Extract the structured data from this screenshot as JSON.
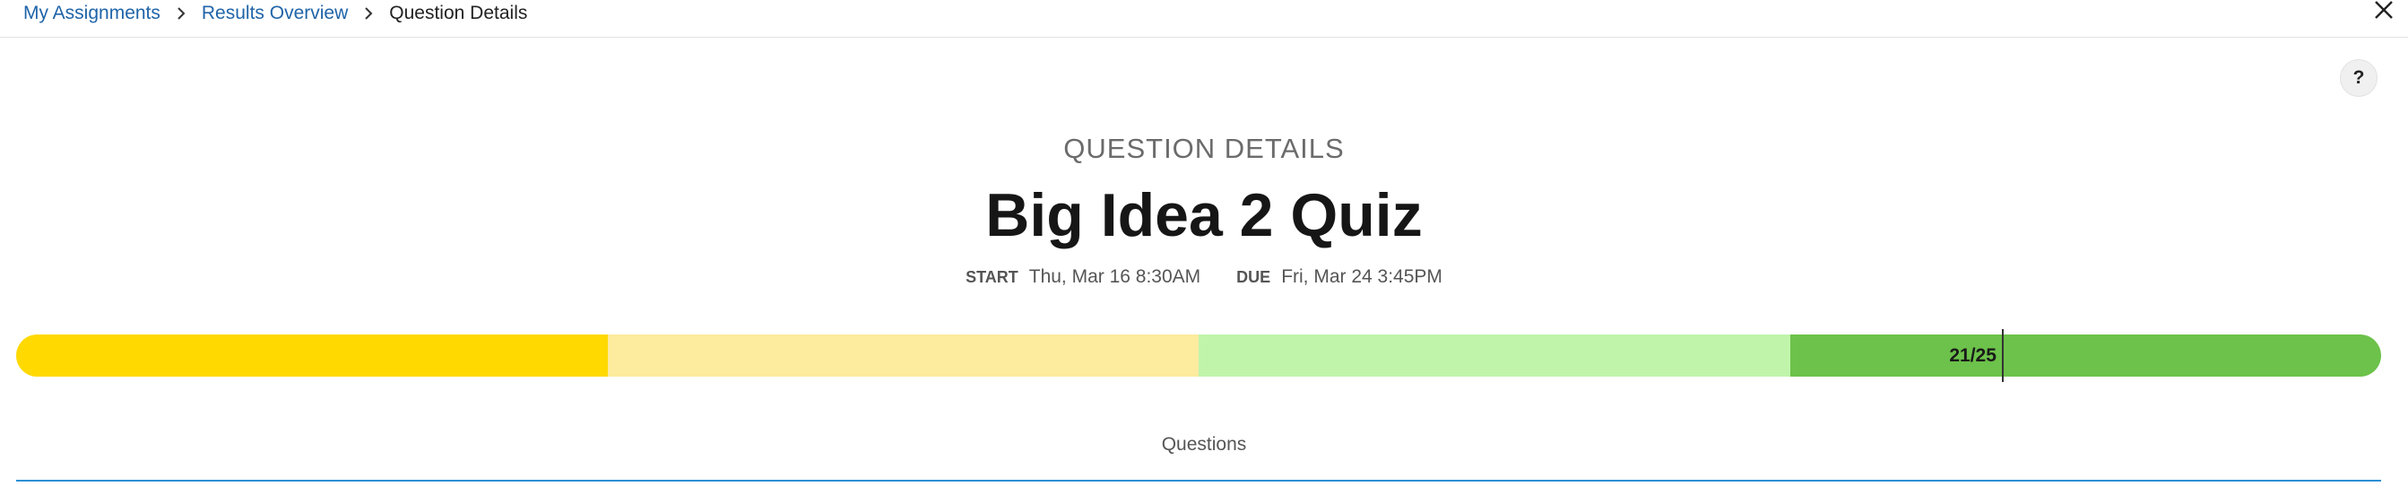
{
  "breadcrumb": {
    "items": [
      {
        "label": "My Assignments",
        "link": true
      },
      {
        "label": "Results Overview",
        "link": true
      },
      {
        "label": "Question Details",
        "link": false
      }
    ]
  },
  "icons": {
    "separator": "chevron-right-icon",
    "close": "close-icon",
    "help": "help-icon"
  },
  "help_button": {
    "label": "?"
  },
  "header": {
    "eyebrow": "QUESTION DETAILS",
    "title": "Big Idea 2 Quiz",
    "start_label": "START",
    "start_value": "Thu, Mar 16 8:30AM",
    "due_label": "DUE",
    "due_value": "Fri, Mar 24 3:45PM"
  },
  "score": {
    "label": "21/25",
    "correct": 21,
    "total": 25,
    "bands": [
      {
        "color": "#ffd900"
      },
      {
        "color": "#fdeb9e"
      },
      {
        "color": "#c0f4ab"
      },
      {
        "color": "#6cc24a"
      }
    ]
  },
  "questions_section": {
    "label": "Questions",
    "accent": "#2d8fd5"
  }
}
